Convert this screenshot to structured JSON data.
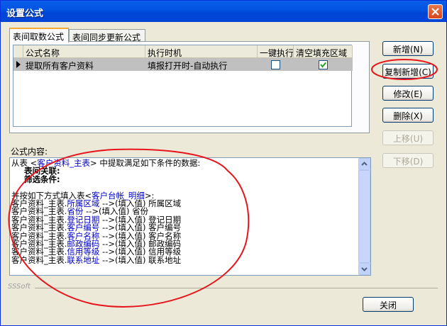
{
  "window": {
    "title": "设置公式"
  },
  "tabs": [
    {
      "label": "表间取数公式"
    },
    {
      "label": "表间同步更新公式"
    }
  ],
  "grid": {
    "headers": [
      "公式名称",
      "执行时机",
      "一键执行",
      "清空填充区域"
    ],
    "rows": [
      {
        "name": "提取所有客户资料",
        "timing": "填报打开时-自动执行",
        "one_click": false,
        "clear_fill": true
      }
    ]
  },
  "buttons": {
    "add": "新增(N)",
    "copy_add": "复制新增(C)",
    "edit": "修改(E)",
    "delete": "删除(X)",
    "move_up": "上移(U)",
    "move_down": "下移(D)",
    "close": "关闭"
  },
  "content": {
    "label": "公式内容:",
    "line1_a": "从表 <",
    "line1_table": "客户资料_主表",
    "line1_b": "> 中提取满足如下条件的数据:",
    "join_label": "表间关联:",
    "filter_label": "筛选条件:",
    "fill_a": "并按如下方式填入表<",
    "fill_table": "客户台帐_明细",
    "fill_b": ">:",
    "mappings": [
      {
        "src_prefix": "客户资料_主表.",
        "src_field": "所属区域",
        "arrow": " -->(填入值) ",
        "target": "所属区域"
      },
      {
        "src_prefix": "客户资料_主表.",
        "src_field": "省份",
        "arrow": " -->(填入值) ",
        "target": "省份"
      },
      {
        "src_prefix": "客户资料_主表.",
        "src_field": "登记日期",
        "arrow": " -->(填入值) ",
        "target": "登记日期"
      },
      {
        "src_prefix": "客户资料_主表.",
        "src_field": "客户编号",
        "arrow": " -->(填入值) ",
        "target": "客户编号"
      },
      {
        "src_prefix": "客户资料_主表.",
        "src_field": "客户名称",
        "arrow": " -->(填入值) ",
        "target": "客户名称"
      },
      {
        "src_prefix": "客户资料_主表.",
        "src_field": "邮政编码",
        "arrow": " -->(填入值) ",
        "target": "邮政编码"
      },
      {
        "src_prefix": "客户资料_主表.",
        "src_field": "信用等级",
        "arrow": " -->(填入值) ",
        "target": "信用等级"
      },
      {
        "src_prefix": "客户资料_主表.",
        "src_field": "联系地址",
        "arrow": " -->(填入值) ",
        "target": "联系地址"
      }
    ]
  },
  "footer": {
    "brand": "SSSoft"
  },
  "colors": {
    "annotation": "#e8141c",
    "title_bar": "#0054e3"
  }
}
